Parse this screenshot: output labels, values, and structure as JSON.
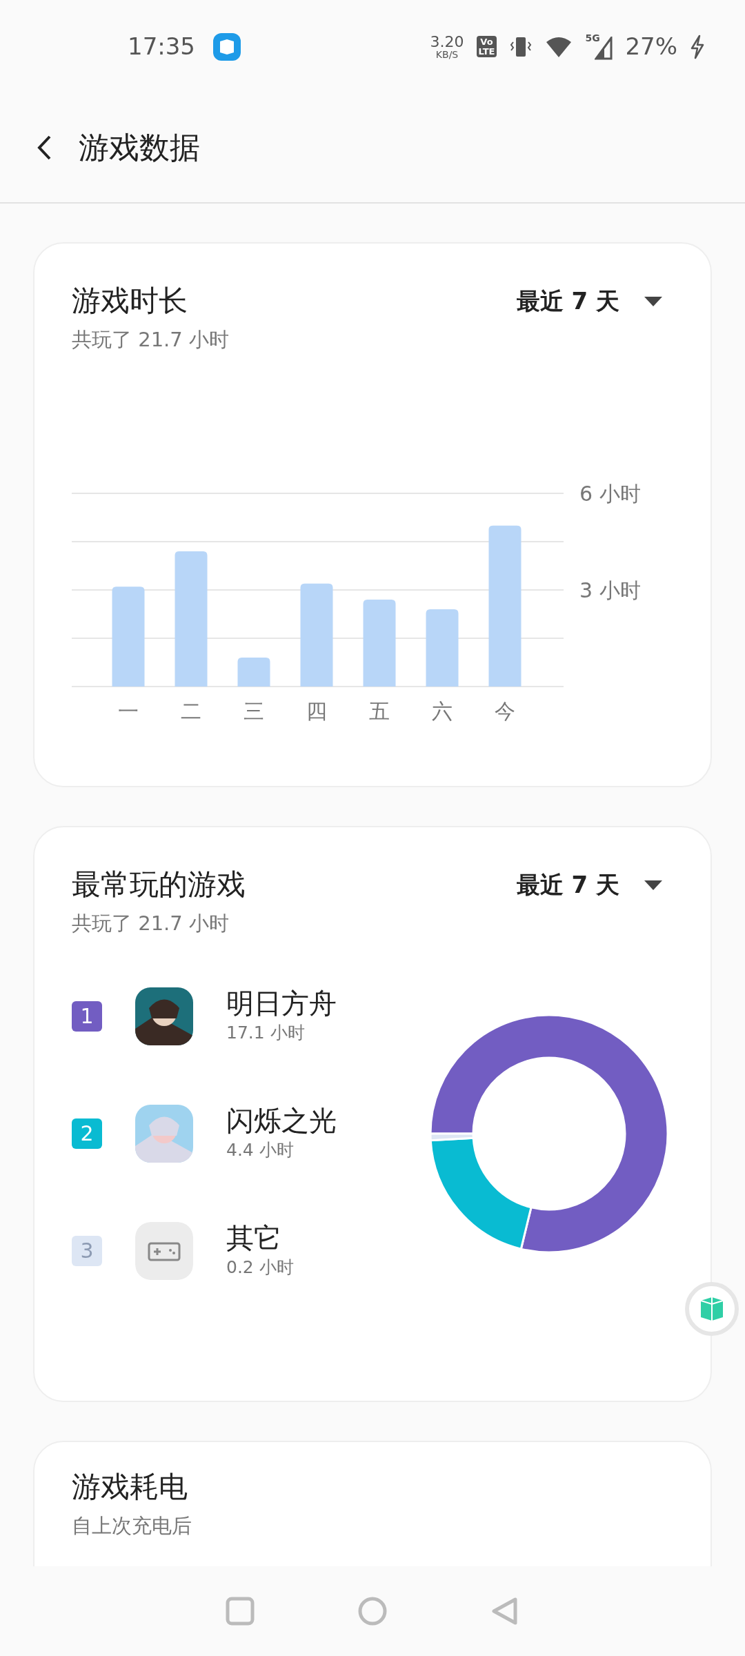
{
  "status_bar": {
    "time": "17:35",
    "net_speed": "3.20",
    "net_unit": "KB/S",
    "volte": [
      "Vo",
      "LTE"
    ],
    "network": "5G",
    "battery": "27%"
  },
  "header": {
    "title": "游戏数据"
  },
  "playtime_card": {
    "title": "游戏时长",
    "subtitle": "共玩了 21.7 小时",
    "range": "最近 7 天",
    "chart_data": {
      "type": "bar",
      "categories": [
        "一",
        "二",
        "三",
        "四",
        "五",
        "六",
        "今"
      ],
      "values": [
        3.1,
        4.2,
        0.9,
        3.2,
        2.7,
        2.4,
        5.0
      ],
      "ylim": [
        0,
        6
      ],
      "yticks": [
        {
          "value": 3,
          "label": "3 小时"
        },
        {
          "value": 6,
          "label": "6 小时"
        }
      ]
    }
  },
  "top_games_card": {
    "title": "最常玩的游戏",
    "subtitle": "共玩了 21.7 小时",
    "range": "最近 7 天",
    "games": [
      {
        "rank": "1",
        "name": "明日方舟",
        "hours": "17.1 小时",
        "color": "#725dc2",
        "kind": "picture"
      },
      {
        "rank": "2",
        "name": "闪烁之光",
        "hours": "4.4 小时",
        "color": "#09bbd2",
        "kind": "picture"
      },
      {
        "rank": "3",
        "name": "其它",
        "hours": "0.2 小时",
        "color": "#dde6f4",
        "kind": "gamepad"
      }
    ],
    "chart_data": {
      "type": "donut",
      "values": [
        78.8,
        20.3,
        0.9
      ]
    }
  },
  "battery_card": {
    "title": "游戏耗电",
    "subtitle": "自上次充电后"
  }
}
